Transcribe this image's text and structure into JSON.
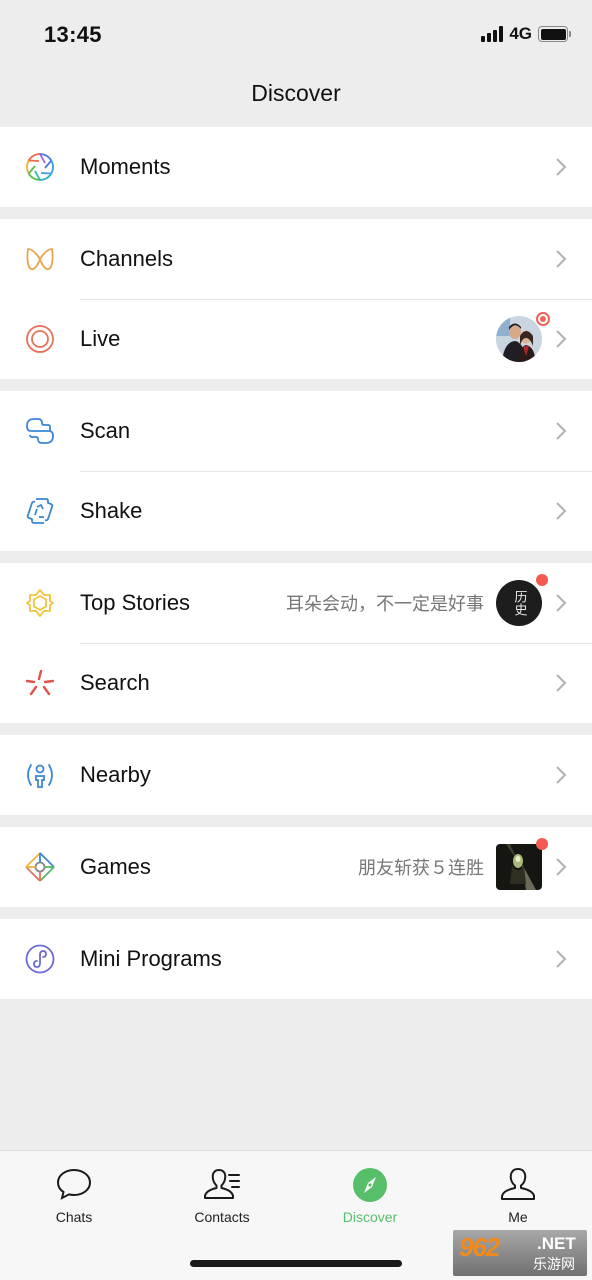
{
  "status_bar": {
    "time": "13:45",
    "network": "4G",
    "signal_bars": 4,
    "battery_percent": 100
  },
  "header": {
    "title": "Discover"
  },
  "groups": [
    {
      "items": [
        {
          "id": "moments",
          "label": "Moments",
          "icon": "moments-aperture-icon"
        }
      ]
    },
    {
      "items": [
        {
          "id": "channels",
          "label": "Channels",
          "icon": "channels-butterfly-icon"
        },
        {
          "id": "live",
          "label": "Live",
          "icon": "live-ring-icon",
          "thumbnail": "live-host-avatar",
          "badge": "live-indicator"
        }
      ]
    },
    {
      "items": [
        {
          "id": "scan",
          "label": "Scan",
          "icon": "scan-icon"
        },
        {
          "id": "shake",
          "label": "Shake",
          "icon": "shake-icon"
        }
      ]
    },
    {
      "items": [
        {
          "id": "top-stories",
          "label": "Top Stories",
          "icon": "top-stories-star-icon",
          "subtext": "耳朵会动，不一定是好事",
          "thumbnail": "history-channel-avatar",
          "thumbnail_text": "历史",
          "badge": "red-dot"
        },
        {
          "id": "search",
          "label": "Search",
          "icon": "search-sparkle-icon"
        }
      ]
    },
    {
      "items": [
        {
          "id": "nearby",
          "label": "Nearby",
          "icon": "nearby-person-icon"
        }
      ]
    },
    {
      "items": [
        {
          "id": "games",
          "label": "Games",
          "icon": "games-diamond-icon",
          "subtext": "朋友斩获５连胜",
          "thumbnail": "game-thumbnail",
          "badge": "red-dot"
        }
      ]
    },
    {
      "items": [
        {
          "id": "mini-programs",
          "label": "Mini Programs",
          "icon": "mini-programs-icon"
        }
      ]
    }
  ],
  "tabbar": {
    "tabs": [
      {
        "id": "chats",
        "label": "Chats",
        "icon": "chat-bubble-icon",
        "active": false
      },
      {
        "id": "contacts",
        "label": "Contacts",
        "icon": "contacts-icon",
        "active": false
      },
      {
        "id": "discover",
        "label": "Discover",
        "icon": "compass-icon",
        "active": true
      },
      {
        "id": "me",
        "label": "Me",
        "icon": "person-icon",
        "active": false
      }
    ]
  },
  "colors": {
    "accent": "#57be6a",
    "badge_red": "#f25a52",
    "background": "#ededed"
  },
  "watermark": {
    "number": "962",
    "domain": ".NET",
    "chinese": "乐游网"
  }
}
